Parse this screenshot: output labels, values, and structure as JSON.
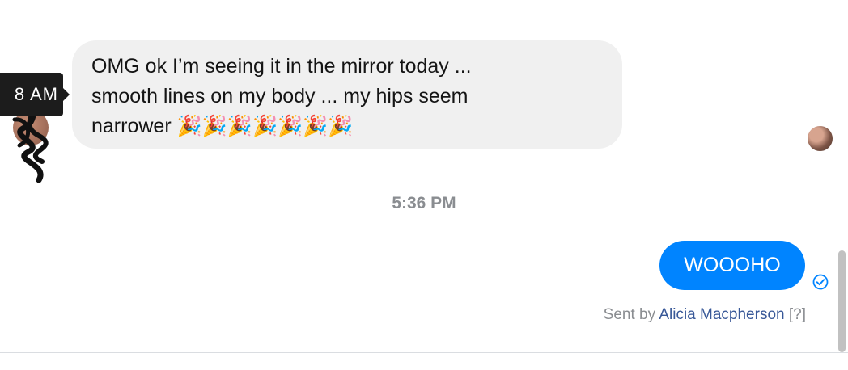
{
  "conversation": {
    "incoming": {
      "tooltip_time": "8 AM",
      "lines": [
        "OMG ok I’m seeing it in the mirror today ...",
        "smooth lines on my body ... my hips seem",
        "narrower"
      ],
      "emojis": "🎉🎉🎉🎉🎉🎉🎉",
      "bubble_color": "#f0f0f0"
    },
    "timestamp": "5:36 PM",
    "outgoing": {
      "text": "WOOOHO",
      "bubble_color": "#0084ff",
      "status_icon": "sent-check-icon"
    },
    "sent_by": {
      "prefix": "Sent by",
      "name": "Alicia Macpherson",
      "help": "[?]"
    }
  },
  "colors": {
    "accent": "#0084ff",
    "link": "#385898",
    "muted": "#8a8d91"
  }
}
